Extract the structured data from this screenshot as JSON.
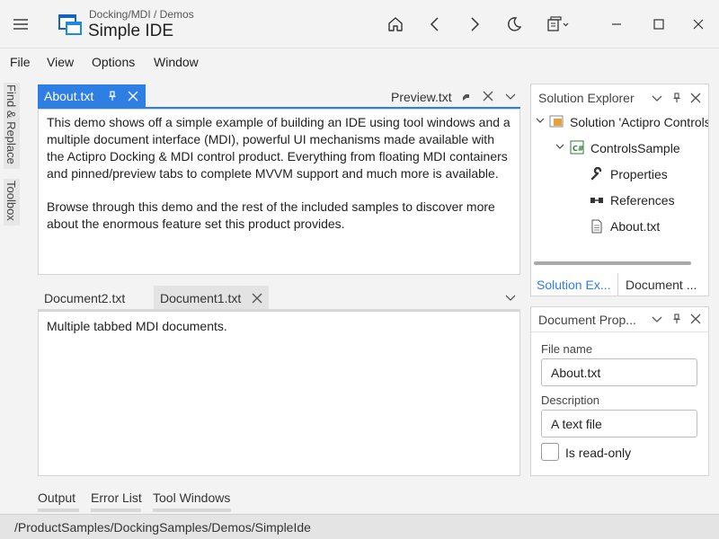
{
  "titlebar": {
    "breadcrumb": "Docking/MDI / Demos",
    "title": "Simple IDE"
  },
  "menu": [
    "File",
    "View",
    "Options",
    "Window"
  ],
  "side_tabs": [
    "Find & Replace",
    "Toolbox"
  ],
  "top_group": {
    "active_tab": "About.txt",
    "preview_tab": "Preview.txt",
    "paragraphs": [
      "This demo shows off a simple example of building an IDE using tool windows and a multiple document interface (MDI), powerful UI mechanisms made available with the Actipro Docking & MDI control product. Everything from floating MDI containers and pinned/preview tabs to complete MVVM support and much more is available.",
      "Browse through this demo and the rest of the included samples to discover more about the enormous feature set this product provides."
    ]
  },
  "bottom_group": {
    "tabs": [
      "Document2.txt",
      "Document1.txt"
    ],
    "content": "Multiple tabbed MDI documents."
  },
  "solution_explorer": {
    "title": "Solution Explorer",
    "items": [
      {
        "label": "Solution 'Actipro Controls",
        "icon": "solution-icon"
      },
      {
        "label": "ControlsSample",
        "icon": "csharp-project-icon"
      },
      {
        "label": "Properties",
        "icon": "wrench-icon"
      },
      {
        "label": "References",
        "icon": "references-icon"
      },
      {
        "label": "About.txt",
        "icon": "file-icon"
      }
    ],
    "tabs": [
      "Solution Ex...",
      "Document ..."
    ]
  },
  "document_properties": {
    "title": "Document Prop...",
    "file_name_label": "File name",
    "file_name_value": "About.txt",
    "description_label": "Description",
    "description_value": "A text file",
    "readonly_label": "Is read-only",
    "readonly_checked": false
  },
  "bottom_tabs": [
    "Output",
    "Error List",
    "Tool Windows"
  ],
  "status": "/ProductSamples/DockingSamples/Demos/SimpleIde",
  "colors": {
    "accent": "#2e7fe3"
  }
}
